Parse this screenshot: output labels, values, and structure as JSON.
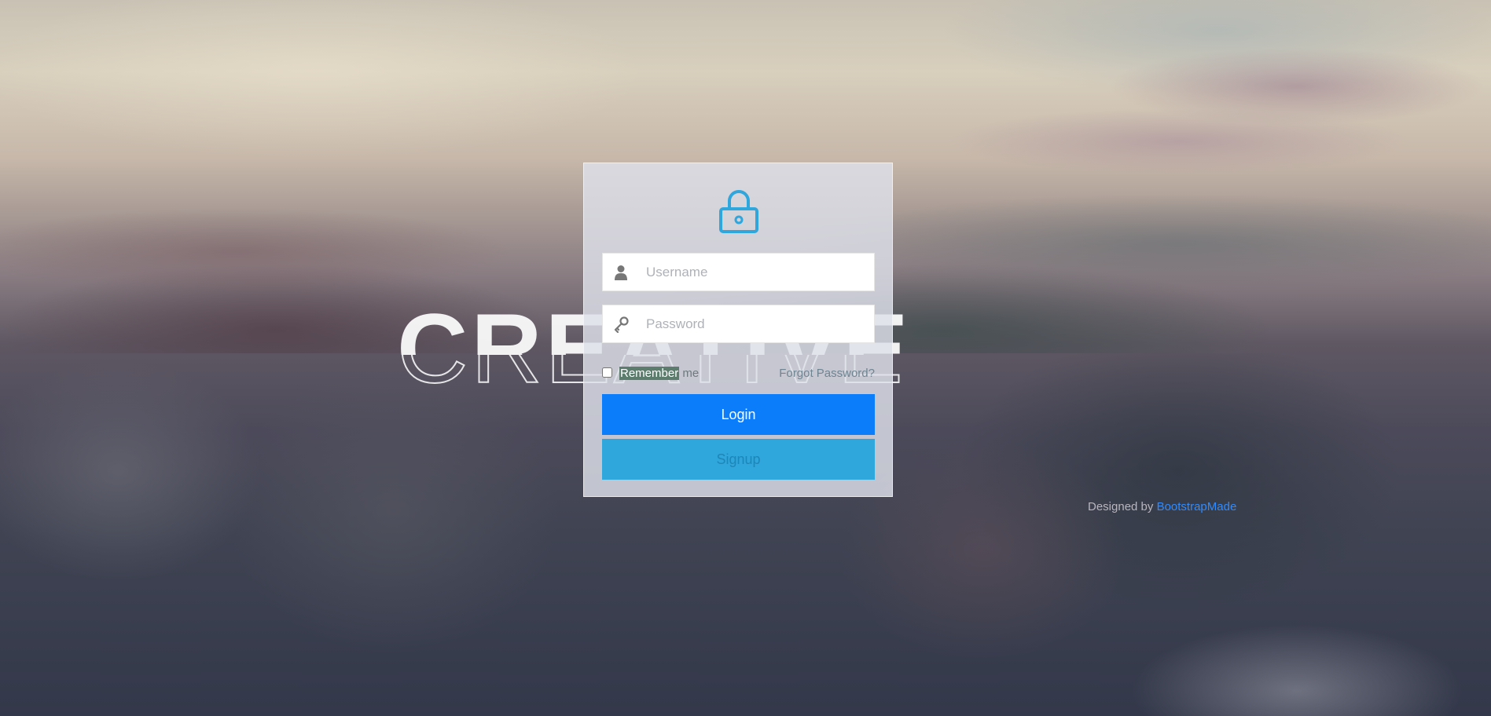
{
  "hero": {
    "text": "CREATIVE"
  },
  "login_form": {
    "lock_icon": "lock-icon",
    "username": {
      "icon": "user-icon",
      "placeholder": "Username",
      "value": ""
    },
    "password": {
      "icon": "key-icon",
      "placeholder": "Password",
      "value": ""
    },
    "remember": {
      "highlighted_part": "Remember",
      "rest": " me",
      "checked": false
    },
    "forgot_password_label": "Forgot Password?",
    "login_button_label": "Login",
    "signup_button_label": "Signup"
  },
  "footer": {
    "designed_by_label": "Designed by",
    "designer_link_label": "BootstrapMade"
  },
  "colors": {
    "login_button": "#0b7dfb",
    "signup_button": "#2fa6dc",
    "lock_icon": "#2fa6dc",
    "link": "#2f8bff"
  }
}
